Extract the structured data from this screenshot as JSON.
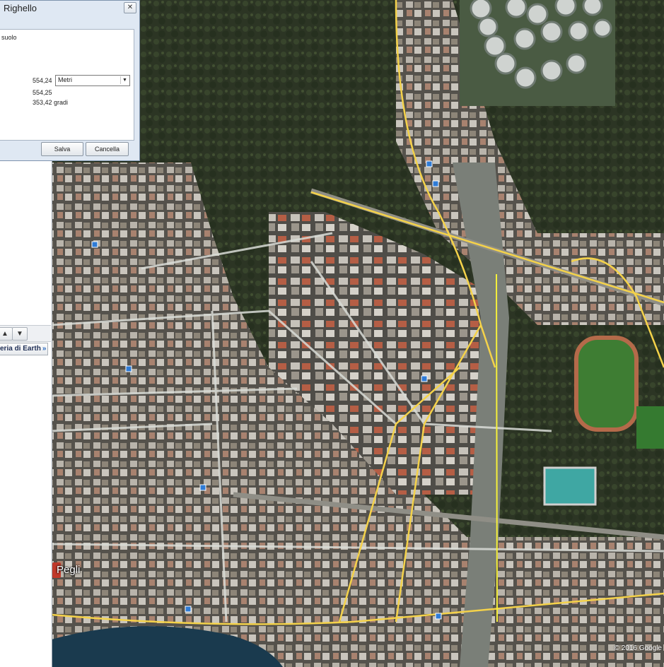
{
  "dialog": {
    "title": "Righello",
    "close_icon": "close-icon",
    "mode_text": "suolo",
    "measure_value": "554,24",
    "unit_selected": "Metri",
    "value_2": "554,25",
    "heading": "353,42 gradi",
    "save_label": "Salva",
    "cancel_label": "Cancella"
  },
  "sidebar": {
    "up_icon": "arrow-up-icon",
    "down_icon": "arrow-down-icon",
    "gallery_label": "eria di Earth",
    "gallery_chevron": "»"
  },
  "map": {
    "place_label": "Pegli",
    "copyright": "© 2016 Google",
    "colors": {
      "road_yellow": "#f4d24a",
      "ruler_line": "#f5f03a",
      "road_white": "#d9dcd7"
    }
  }
}
